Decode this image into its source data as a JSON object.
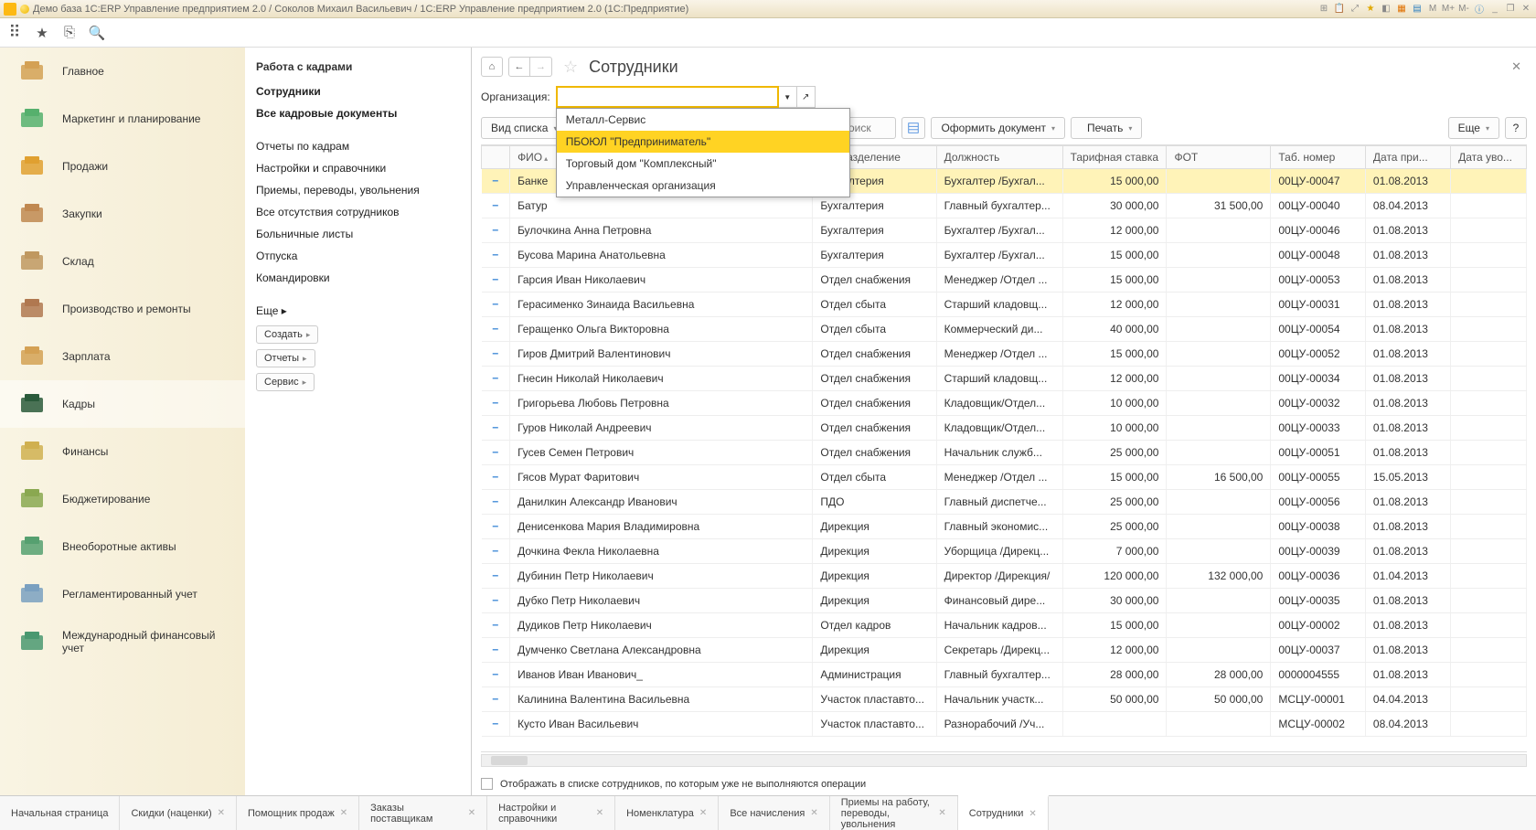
{
  "window_title": "Демо база 1С:ERP Управление предприятием 2.0 / Соколов Михаил Васильевич / 1С:ERP Управление предприятием 2.0  (1С:Предприятие)",
  "title_icons": {
    "m": "M",
    "m1": "M+",
    "m2": "M-",
    "min": "_",
    "max": "❐",
    "close": "✕"
  },
  "sidebar": [
    {
      "id": "main",
      "label": "Главное"
    },
    {
      "id": "marketing",
      "label": "Маркетинг и планирование"
    },
    {
      "id": "sales",
      "label": "Продажи"
    },
    {
      "id": "purchase",
      "label": "Закупки"
    },
    {
      "id": "warehouse",
      "label": "Склад"
    },
    {
      "id": "production",
      "label": "Производство и ремонты"
    },
    {
      "id": "salary",
      "label": "Зарплата"
    },
    {
      "id": "hr",
      "label": "Кадры"
    },
    {
      "id": "finance",
      "label": "Финансы"
    },
    {
      "id": "budget",
      "label": "Бюджетирование"
    },
    {
      "id": "assets",
      "label": "Внеоборотные активы"
    },
    {
      "id": "reg",
      "label": "Регламентированный учет"
    },
    {
      "id": "intl",
      "label": "Международный финансовый учет"
    }
  ],
  "subpanel": {
    "head": "Работа с кадрами",
    "links1": [
      "Сотрудники",
      "Все кадровые документы"
    ],
    "links2": [
      "Отчеты по кадрам",
      "Настройки и справочники",
      "Приемы, переводы, увольнения",
      "Все отсутствия сотрудников",
      "Больничные листы",
      "Отпуска",
      "Командировки"
    ],
    "more": "Еще ▸",
    "btns": [
      "Создать",
      "Отчеты",
      "Сервис"
    ]
  },
  "page_title": "Сотрудники",
  "org_label": "Организация:",
  "dropdown": [
    "Металл-Сервис",
    "ПБОЮЛ \"Предприниматель\"",
    "Торговый дом \"Комплексный\"",
    "Управленческая организация"
  ],
  "toolbar": {
    "view": "Вид списка",
    "search_ph": "поиск",
    "doc": "Оформить документ",
    "print": "Печать",
    "more": "Еще",
    "help": "?"
  },
  "cols": [
    "",
    "ФИО",
    "Подразделение",
    "Должность",
    "Тарифная ставка",
    "ФОТ",
    "Таб. номер",
    "Дата при...",
    "Дата уво..."
  ],
  "rows": [
    [
      "Банке",
      "Бухгалтерия",
      "Бухгалтер /Бухгал...",
      "15 000,00",
      "",
      "00ЦУ-00047",
      "01.08.2013",
      ""
    ],
    [
      "Батур",
      "Бухгалтерия",
      "Главный бухгалтер...",
      "30 000,00",
      "31 500,00",
      "00ЦУ-00040",
      "08.04.2013",
      ""
    ],
    [
      "Булочкина Анна Петровна",
      "Бухгалтерия",
      "Бухгалтер /Бухгал...",
      "12 000,00",
      "",
      "00ЦУ-00046",
      "01.08.2013",
      ""
    ],
    [
      "Бусова Марина Анатольевна",
      "Бухгалтерия",
      "Бухгалтер /Бухгал...",
      "15 000,00",
      "",
      "00ЦУ-00048",
      "01.08.2013",
      ""
    ],
    [
      "Гарсия Иван Николаевич",
      "Отдел снабжения",
      "Менеджер /Отдел ...",
      "15 000,00",
      "",
      "00ЦУ-00053",
      "01.08.2013",
      ""
    ],
    [
      "Герасименко Зинаида Васильевна",
      "Отдел сбыта",
      "Старший кладовщ...",
      "12 000,00",
      "",
      "00ЦУ-00031",
      "01.08.2013",
      ""
    ],
    [
      "Геращенко Ольга Викторовна",
      "Отдел сбыта",
      "Коммерческий ди...",
      "40 000,00",
      "",
      "00ЦУ-00054",
      "01.08.2013",
      ""
    ],
    [
      "Гиров Дмитрий Валентинович",
      "Отдел снабжения",
      "Менеджер /Отдел ...",
      "15 000,00",
      "",
      "00ЦУ-00052",
      "01.08.2013",
      ""
    ],
    [
      "Гнесин Николай Николаевич",
      "Отдел снабжения",
      "Старший кладовщ...",
      "12 000,00",
      "",
      "00ЦУ-00034",
      "01.08.2013",
      ""
    ],
    [
      "Григорьева Любовь Петровна",
      "Отдел снабжения",
      "Кладовщик/Отдел...",
      "10 000,00",
      "",
      "00ЦУ-00032",
      "01.08.2013",
      ""
    ],
    [
      "Гуров Николай Андреевич",
      "Отдел снабжения",
      "Кладовщик/Отдел...",
      "10 000,00",
      "",
      "00ЦУ-00033",
      "01.08.2013",
      ""
    ],
    [
      "Гусев Семен Петрович",
      "Отдел снабжения",
      "Начальник служб...",
      "25 000,00",
      "",
      "00ЦУ-00051",
      "01.08.2013",
      ""
    ],
    [
      "Гясов Мурат Фаритович",
      "Отдел сбыта",
      "Менеджер /Отдел ...",
      "15 000,00",
      "16 500,00",
      "00ЦУ-00055",
      "15.05.2013",
      ""
    ],
    [
      "Данилкин Александр Иванович",
      "ПДО",
      "Главный диспетче...",
      "25 000,00",
      "",
      "00ЦУ-00056",
      "01.08.2013",
      ""
    ],
    [
      "Денисенкова Мария Владимировна",
      "Дирекция",
      "Главный экономис...",
      "25 000,00",
      "",
      "00ЦУ-00038",
      "01.08.2013",
      ""
    ],
    [
      "Дочкина Фекла Николаевна",
      "Дирекция",
      "Уборщица /Дирекц...",
      "7 000,00",
      "",
      "00ЦУ-00039",
      "01.08.2013",
      ""
    ],
    [
      "Дубинин Петр Николаевич",
      "Дирекция",
      "Директор /Дирекция/",
      "120 000,00",
      "132 000,00",
      "00ЦУ-00036",
      "01.04.2013",
      ""
    ],
    [
      "Дубко Петр Николаевич",
      "Дирекция",
      "Финансовый дире...",
      "30 000,00",
      "",
      "00ЦУ-00035",
      "01.08.2013",
      ""
    ],
    [
      "Дудиков Петр Николаевич",
      "Отдел кадров",
      "Начальник кадров...",
      "15 000,00",
      "",
      "00ЦУ-00002",
      "01.08.2013",
      ""
    ],
    [
      "Думченко Светлана Александровна",
      "Дирекция",
      "Секретарь /Дирекц...",
      "12 000,00",
      "",
      "00ЦУ-00037",
      "01.08.2013",
      ""
    ],
    [
      "Иванов Иван Иванович_",
      "Администрация",
      "Главный бухгалтер...",
      "28 000,00",
      "28 000,00",
      "0000004555",
      "01.08.2013",
      ""
    ],
    [
      "Калинина Валентина Васильевна",
      "Участок пластавто...",
      "Начальник участк...",
      "50 000,00",
      "50 000,00",
      "МСЦУ-00001",
      "04.04.2013",
      ""
    ],
    [
      "Кусто Иван Васильевич",
      "Участок пластавто...",
      "Разнорабочий /Уч...",
      "",
      "",
      "МСЦУ-00002",
      "08.04.2013",
      ""
    ]
  ],
  "footer_chk": "Отображать в списке сотрудников, по которым уже не выполняются операции",
  "tabs": [
    "Начальная страница",
    "Скидки (наценки)",
    "Помощник продаж",
    "Заказы поставщикам",
    "Настройки и справочники",
    "Номенклатура",
    "Все начисления",
    "Приемы на работу, переводы, увольнения",
    "Сотрудники"
  ]
}
